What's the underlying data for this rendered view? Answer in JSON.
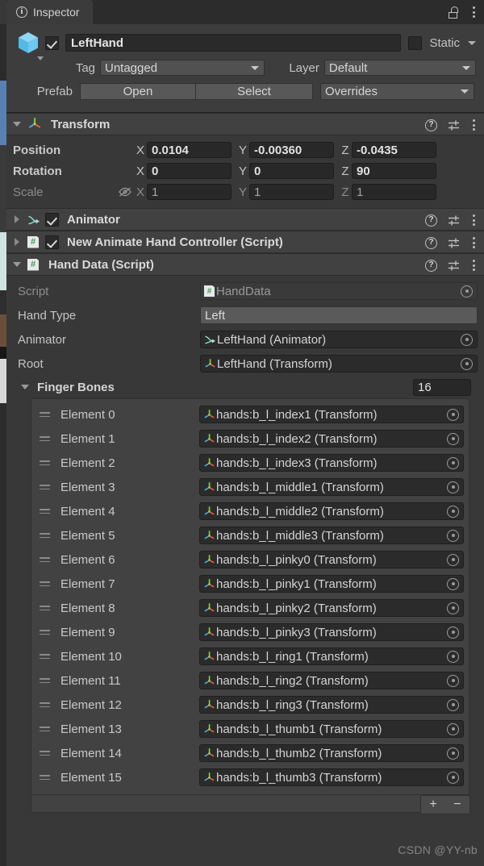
{
  "window": {
    "tab_label": "Inspector",
    "tab_icon": "info-icon",
    "lock_icon": "lock-open-icon",
    "menu_icon": "kebab-menu-icon"
  },
  "gameobject": {
    "icon": "cube-icon",
    "enabled": true,
    "name": "LeftHand",
    "static_label": "Static",
    "static_checked": false,
    "tag_label": "Tag",
    "tag_value": "Untagged",
    "layer_label": "Layer",
    "layer_value": "Default",
    "prefab_label": "Prefab",
    "prefab_open": "Open",
    "prefab_select": "Select",
    "prefab_overrides": "Overrides"
  },
  "components": [
    {
      "name": "transform-component",
      "title": "Transform",
      "icon": "transform-gizmo-icon",
      "expanded": true,
      "has_enable_toggle": false
    },
    {
      "name": "animator-component",
      "title": "Animator",
      "icon": "animator-icon",
      "expanded": false,
      "has_enable_toggle": true,
      "enabled": true
    },
    {
      "name": "new-animate-hand-controller-component",
      "title": "New Animate Hand Controller (Script)",
      "icon": "csharp-script-icon",
      "expanded": false,
      "has_enable_toggle": true,
      "enabled": true
    },
    {
      "name": "hand-data-component",
      "title": "Hand Data (Script)",
      "icon": "csharp-script-icon",
      "expanded": true,
      "has_enable_toggle": false
    }
  ],
  "transform": {
    "rows": [
      {
        "label": "Position",
        "x": "0.0104",
        "y": "-0.00360",
        "z": "-0.0435",
        "dim": false,
        "has_link_icon": false
      },
      {
        "label": "Rotation",
        "x": "0",
        "y": "0",
        "z": "90",
        "dim": false,
        "has_link_icon": false
      },
      {
        "label": "Scale",
        "x": "1",
        "y": "1",
        "z": "1",
        "dim": true,
        "has_link_icon": true,
        "link_icon": "constrain-proportions-off-icon"
      }
    ],
    "axis_x": "X",
    "axis_y": "Y",
    "axis_z": "Z"
  },
  "hand_data": {
    "script_label": "Script",
    "script_value": "HandData",
    "hand_type_label": "Hand Type",
    "hand_type_value": "Left",
    "animator_label": "Animator",
    "animator_value": "LeftHand (Animator)",
    "root_label": "Root",
    "root_value": "LeftHand (Transform)",
    "finger_bones_label": "Finger Bones",
    "finger_bones_size": "16",
    "element_label_prefix": "Element",
    "elements": [
      {
        "index": "Element 0",
        "value": "hands:b_l_index1 (Transform)"
      },
      {
        "index": "Element 1",
        "value": "hands:b_l_index2 (Transform)"
      },
      {
        "index": "Element 2",
        "value": "hands:b_l_index3 (Transform)"
      },
      {
        "index": "Element 3",
        "value": "hands:b_l_middle1 (Transform)"
      },
      {
        "index": "Element 4",
        "value": "hands:b_l_middle2 (Transform)"
      },
      {
        "index": "Element 5",
        "value": "hands:b_l_middle3 (Transform)"
      },
      {
        "index": "Element 6",
        "value": "hands:b_l_pinky0 (Transform)"
      },
      {
        "index": "Element 7",
        "value": "hands:b_l_pinky1 (Transform)"
      },
      {
        "index": "Element 8",
        "value": "hands:b_l_pinky2 (Transform)"
      },
      {
        "index": "Element 9",
        "value": "hands:b_l_pinky3 (Transform)"
      },
      {
        "index": "Element 10",
        "value": "hands:b_l_ring1 (Transform)"
      },
      {
        "index": "Element 11",
        "value": "hands:b_l_ring2 (Transform)"
      },
      {
        "index": "Element 12",
        "value": "hands:b_l_ring3 (Transform)"
      },
      {
        "index": "Element 13",
        "value": "hands:b_l_thumb1 (Transform)"
      },
      {
        "index": "Element 14",
        "value": "hands:b_l_thumb2 (Transform)"
      },
      {
        "index": "Element 15",
        "value": "hands:b_l_thumb3 (Transform)"
      }
    ],
    "add_button": "+",
    "remove_button": "−"
  },
  "watermark": "CSDN @YY-nb",
  "colors": {
    "panel_bg": "#383838",
    "header_bg": "#3d3d3d",
    "component_header_bg": "#414141",
    "field_bg": "#282828",
    "dropdown_bg": "#5a5a5a",
    "list_bg": "#424242",
    "text": "#c4c4c4",
    "text_bright": "#e4e4e4",
    "text_dim": "#8e8e8e",
    "accent_blue": "#5a7fb5",
    "script_green": "#3aa05a"
  }
}
